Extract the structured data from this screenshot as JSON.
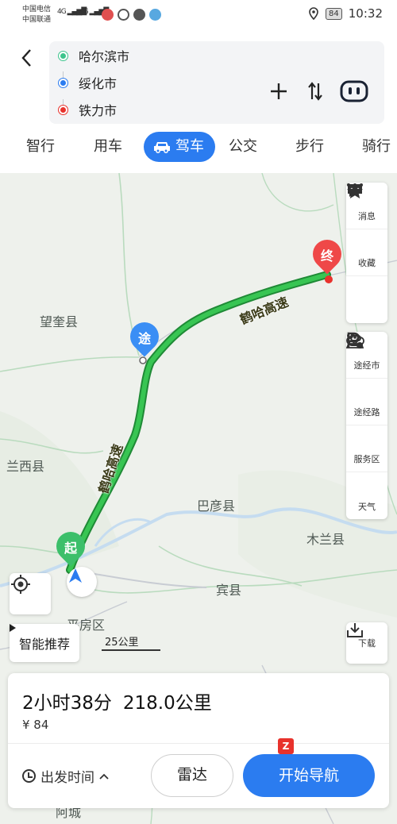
{
  "status_bar": {
    "carrier1": "中国电信",
    "carrier2": "中国联通",
    "net1": "4G",
    "net2": "4G",
    "battery": "84",
    "time": "10:32"
  },
  "route": {
    "origin": "哈尔滨市",
    "waypoint": "绥化市",
    "destination": "铁力市",
    "colors": {
      "origin": "#3cc48c",
      "waypoint": "#2b7cf0",
      "destination": "#e8322c"
    }
  },
  "mode_tabs": [
    "智行",
    "用车",
    "驾车",
    "公交",
    "步行",
    "骑行"
  ],
  "active_tab": "驾车",
  "map": {
    "places": [
      "望奎县",
      "兰西县",
      "巴彦县",
      "木兰县",
      "宾县",
      "平房区",
      "阿城"
    ],
    "road_labels": [
      "鹤哈高速",
      "鹤哈高速"
    ],
    "markers": {
      "start": "起",
      "via": "途",
      "end": "终"
    },
    "route_color": "#2fb64a"
  },
  "side_tools": {
    "group1": [
      {
        "icon": "message-icon",
        "label": "消息"
      },
      {
        "icon": "star-icon",
        "label": "收藏"
      },
      {
        "icon": "more-icon",
        "label": ""
      }
    ],
    "group2": [
      {
        "icon": "waypoint-city-icon",
        "label": "途经市"
      },
      {
        "icon": "waypoint-road-icon",
        "label": "途经路"
      },
      {
        "icon": "service-area-icon",
        "label": "服务区"
      },
      {
        "icon": "weather-icon",
        "label": "天气"
      }
    ]
  },
  "recommend_label": "智能推荐",
  "scale_label": "25公里",
  "download_label": "下载",
  "summary": {
    "duration": "2小时38分",
    "distance": "218.0公里",
    "cost": "¥ 84"
  },
  "depart_label": "出发时间",
  "radar_label": "雷达",
  "navigate_label": "开始导航",
  "navigate_badge": "Z"
}
